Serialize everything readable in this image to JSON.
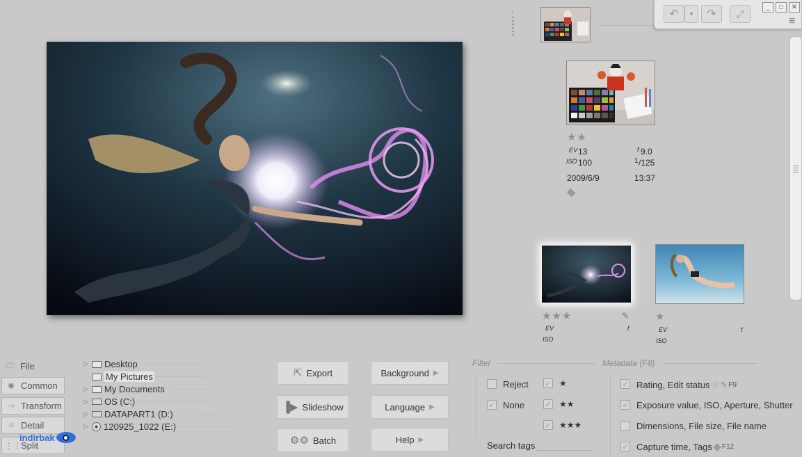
{
  "main_image": {
    "description_icon": "underwater-fantasy-photo"
  },
  "film_strip": {
    "top_thumb_icon": "color-checker-thumbnail"
  },
  "info_panel": {
    "rating": "★★",
    "ev_label": "EV",
    "ev_value": "13",
    "iso_label": "ISO",
    "iso_value": "100",
    "aperture_label": "f",
    "aperture_value": "9.0",
    "shutter_prefix": "1",
    "shutter_value": "/125",
    "date": "2009/6/9",
    "time": "13:37",
    "tag_icon": "tag-icon"
  },
  "thumbnails": [
    {
      "rating": "★★★",
      "ev_label": "EV",
      "iso_label": "ISO",
      "f_label": "f",
      "edit_icon": "pencil-icon"
    },
    {
      "rating": "★",
      "ev_label": "EV",
      "iso_label": "ISO",
      "f_label": "f"
    }
  ],
  "sidebar": {
    "items": [
      {
        "label": "File",
        "icon": "folder-open-icon"
      },
      {
        "label": "Common",
        "icon": "sparkle-icon"
      },
      {
        "label": "Transform",
        "icon": "transform-icon"
      },
      {
        "label": "Detail",
        "icon": "detail-icon"
      },
      {
        "label": "Split",
        "icon": "split-icon"
      }
    ]
  },
  "folder_tree": {
    "items": [
      {
        "label": "Desktop",
        "type": "folder",
        "expandable": true
      },
      {
        "label": "My Pictures",
        "type": "folder",
        "expandable": false,
        "selected": true
      },
      {
        "label": "My Documents",
        "type": "folder",
        "expandable": true
      },
      {
        "label": "OS (C:)",
        "type": "drive",
        "expandable": true
      },
      {
        "label": "DATAPART1 (D:)",
        "type": "drive",
        "expandable": true
      },
      {
        "label": "120925_1022 (E:)",
        "type": "disc",
        "expandable": true
      }
    ]
  },
  "actions": {
    "export": "Export",
    "slideshow": "Slideshow",
    "batch": "Batch",
    "background": "Background",
    "language": "Language",
    "help": "Help"
  },
  "filter": {
    "title": "Filter",
    "reject": "Reject",
    "none": "None",
    "star1": "★",
    "star2": "★★",
    "star3": "★★★",
    "search_tags": "Search tags"
  },
  "metadata": {
    "title": "Metadata (F8)",
    "options": [
      {
        "label": "Rating, Edit status",
        "suffix": "F9",
        "checked": true
      },
      {
        "label": "Exposure value, ISO, Aperture, Shutter",
        "suffix": "",
        "checked": true
      },
      {
        "label": "Dimensions, File size, File name",
        "suffix": "",
        "checked": false
      },
      {
        "label": "Capture time, Tags",
        "suffix": "F12",
        "checked": true
      }
    ]
  },
  "watermark": {
    "text": "indirbak"
  },
  "colors": {
    "background": "#c9c9c9",
    "glow": "#e38cf0",
    "watermark": "#2f6fe0"
  }
}
